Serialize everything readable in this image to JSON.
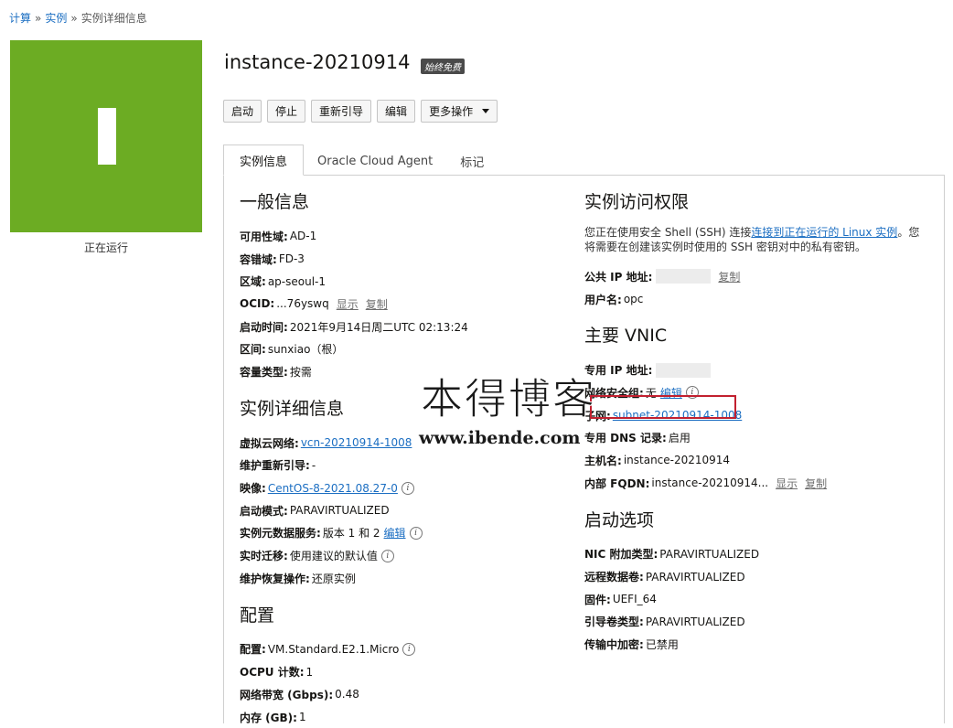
{
  "breadcrumb": {
    "compute": "计算",
    "sep1": "»",
    "instances": "实例",
    "sep2": "»",
    "current": "实例详细信息"
  },
  "status": {
    "text": "正在运行",
    "color": "#6cac23"
  },
  "instance": {
    "name": "instance-20210914",
    "badge": "始终免费"
  },
  "toolbar": {
    "start": "启动",
    "stop": "停止",
    "reboot": "重新引导",
    "edit": "编辑",
    "more": "更多操作"
  },
  "tabs": [
    "实例信息",
    "Oracle Cloud Agent",
    "标记"
  ],
  "general": {
    "title": "一般信息",
    "ad_label": "可用性域:",
    "ad": "AD-1",
    "fd_label": "容错域:",
    "fd": "FD-3",
    "region_label": "区域:",
    "region": "ap-seoul-1",
    "ocid_label": "OCID:",
    "ocid": "...76yswq",
    "show": "显示",
    "copy": "复制",
    "launch_label": "启动时间:",
    "launch": "2021年9月14日周二UTC 02:13:24",
    "compartment_label": "区间:",
    "compartment": "sunxiao（根）",
    "capacity_label": "容量类型:",
    "capacity": "按需"
  },
  "details": {
    "title": "实例详细信息",
    "vcn_label": "虚拟云网络:",
    "vcn": "vcn-20210914-1008",
    "maint_label": "维护重新引导:",
    "maint": "-",
    "image_label": "映像:",
    "image": "CentOS-8-2021.08.27-0",
    "launch_mode_label": "启动模式:",
    "launch_mode": "PARAVIRTUALIZED",
    "imds_label": "实例元数据服务:",
    "imds": "版本 1 和 2",
    "imds_edit": "编辑",
    "migration_label": "实时迁移:",
    "migration": "使用建议的默认值",
    "recovery_label": "维护恢复操作:",
    "recovery": "还原实例"
  },
  "config": {
    "title": "配置",
    "shape_label": "配置:",
    "shape": "VM.Standard.E2.1.Micro",
    "ocpu_label": "OCPU 计数:",
    "ocpu": "1",
    "bw_label": "网络带宽 (Gbps):",
    "bw": "0.48",
    "mem_label": "内存 (GB):",
    "mem": "1"
  },
  "access": {
    "title": "实例访问权限",
    "text_before": "您正在使用安全 Shell (SSH) 连接",
    "link": "连接到正在运行的 Linux 实例",
    "text_after": "。您将需要在创建该实例时使用的 SSH 密钥对中的私有密钥。",
    "public_ip_label": "公共 IP 地址:",
    "copy": "复制",
    "user_label": "用户名:",
    "user": "opc"
  },
  "vnic": {
    "title": "主要 VNIC",
    "private_ip_label": "专用 IP 地址:",
    "nsg_label": "网络安全组:",
    "nsg": "无",
    "nsg_edit": "编辑",
    "subnet_label": "子网:",
    "subnet": "subnet-20210914-1008",
    "dns_label": "专用 DNS 记录:",
    "dns": "启用",
    "hostname_label": "主机名:",
    "hostname": "instance-20210914",
    "fqdn_label": "内部 FQDN:",
    "fqdn": "instance-20210914...",
    "show": "显示",
    "copy": "复制"
  },
  "boot": {
    "title": "启动选项",
    "nic_label": "NIC 附加类型:",
    "nic": "PARAVIRTUALIZED",
    "remote_label": "远程数据卷:",
    "remote": "PARAVIRTUALIZED",
    "fw_label": "固件:",
    "fw": "UEFI_64",
    "bootvol_label": "引导卷类型:",
    "bootvol": "PARAVIRTUALIZED",
    "transit_label": "传输中加密:",
    "transit": "已禁用"
  },
  "watermark": {
    "cn": "本得博客",
    "url": "www.ibende.com"
  }
}
